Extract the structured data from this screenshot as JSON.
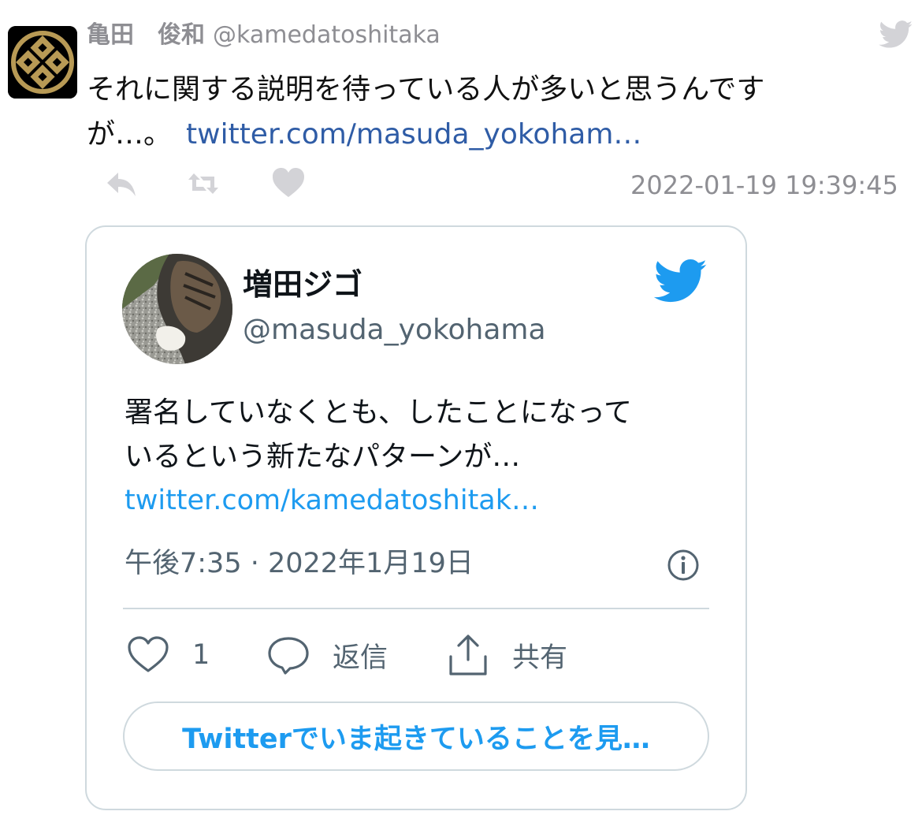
{
  "tweet": {
    "author_name": "亀田　俊和",
    "author_handle": "@kamedatoshitaka",
    "text_line1": "それに関する説明を待っている人が多いと思うんです",
    "text_line2": "が…。",
    "link_text": "twitter.com/masuda_yokoham…",
    "timestamp": "2022-01-19 19:39:45",
    "icons": [
      "reply-icon",
      "retweet-icon",
      "like-icon",
      "twitter-bird-icon"
    ]
  },
  "embed": {
    "author_name": "増田ジゴ",
    "author_handle": "@masuda_yokohama",
    "text_line1": "署名していなくとも、したことになって",
    "text_line2": "いるという新たなパターンが…",
    "link_text": "twitter.com/kamedatoshitak…",
    "date": "午後7:35 · 2022年1月19日",
    "like_count": "1",
    "reply_label": "返信",
    "share_label": "共有",
    "cta_label": "Twitterでいま起きていることを見…",
    "icons": [
      "twitter-bird-icon",
      "info-icon",
      "heart-icon",
      "reply-bubble-icon",
      "share-icon"
    ]
  },
  "colors": {
    "link_dark": "#2f5ca6",
    "link_blue": "#1d9bf0",
    "twitter_blue": "#1d9bf0",
    "muted_gray": "#8e8e93",
    "icon_light_gray": "#d3d3d7",
    "card_border": "#cfd9de"
  }
}
